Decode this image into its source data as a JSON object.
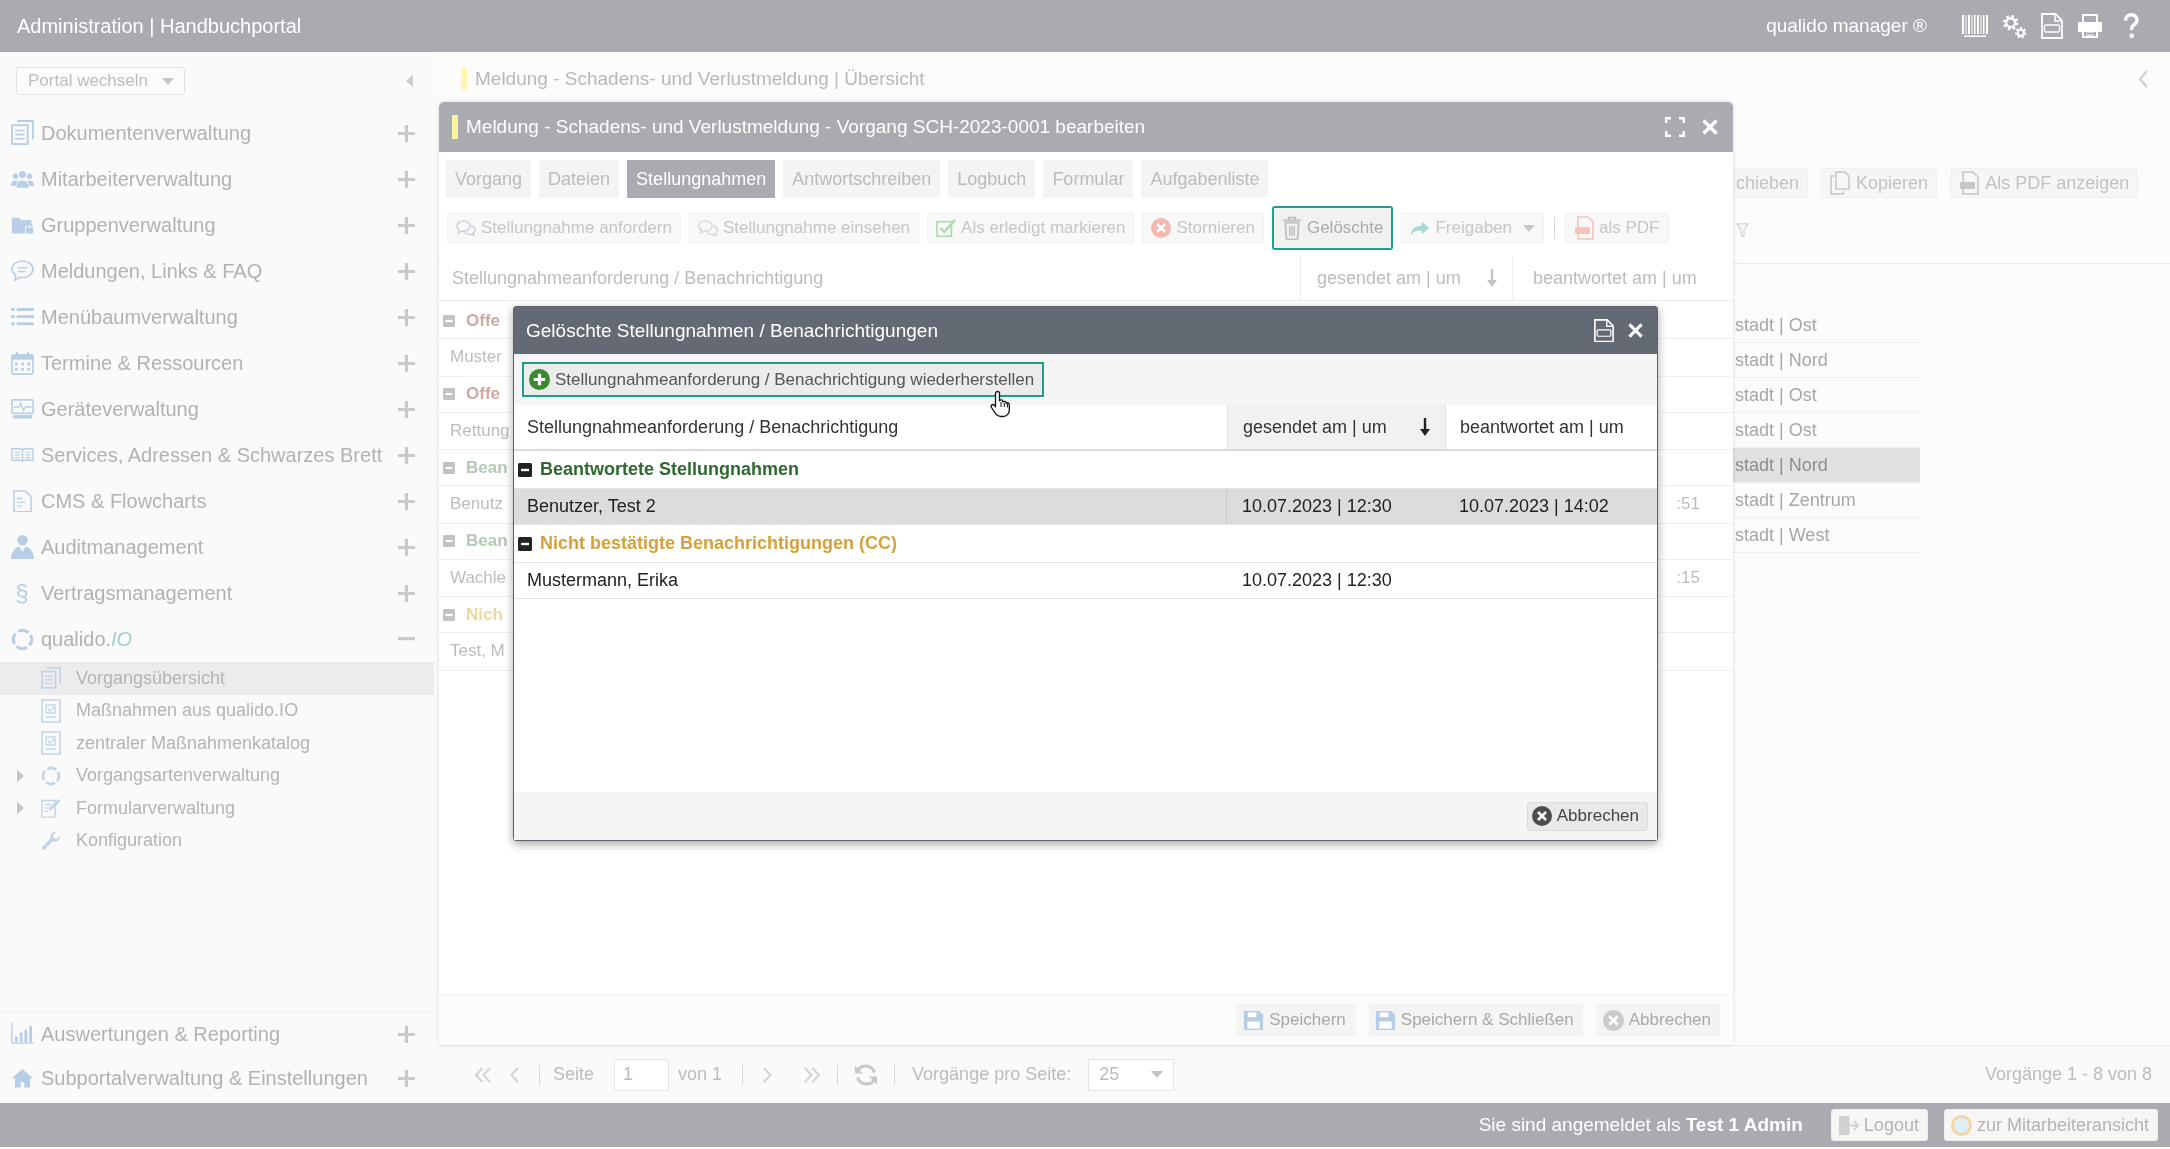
{
  "top_bar": {
    "title": "Administration | Handbuchportal",
    "product": "qualido manager ®"
  },
  "sidebar": {
    "portal_switch": "Portal wechseln",
    "items": [
      {
        "label": "Dokumentenverwaltung",
        "expanded": false
      },
      {
        "label": "Mitarbeiterverwaltung",
        "expanded": false
      },
      {
        "label": "Gruppenverwaltung",
        "expanded": false
      },
      {
        "label": "Meldungen, Links & FAQ",
        "expanded": false
      },
      {
        "label": "Menübaumverwaltung",
        "expanded": false
      },
      {
        "label": "Termine & Ressourcen",
        "expanded": false
      },
      {
        "label": "Geräteverwaltung",
        "expanded": false
      },
      {
        "label": "Services, Adressen & Schwarzes Brett",
        "expanded": false
      },
      {
        "label": "CMS & Flowcharts",
        "expanded": false
      },
      {
        "label": "Auditmanagement",
        "expanded": false
      },
      {
        "label": "Vertragsmanagement",
        "symbol": "§",
        "expanded": false
      },
      {
        "label": "qualido.*IO*",
        "expanded": true,
        "children": [
          {
            "label": "Vorgangsübersicht",
            "kind": "leaf",
            "selected": true
          },
          {
            "label": "Maßnahmen aus qualido.IO",
            "kind": "leaf",
            "selected": false
          },
          {
            "label": "zentraler Maßnahmenkatalog",
            "kind": "leaf",
            "selected": false
          },
          {
            "label": "Vorgangsartenverwaltung",
            "kind": "branch",
            "selected": false
          },
          {
            "label": "Formularverwaltung",
            "kind": "branch",
            "selected": false
          },
          {
            "label": "Konfiguration",
            "kind": "leaf",
            "selected": false
          }
        ]
      }
    ],
    "bottom_items": [
      {
        "label": "Auswertungen & Reporting",
        "expanded": false
      },
      {
        "label": "Subportalverwaltung & Einstellungen",
        "expanded": false
      }
    ]
  },
  "page": {
    "title": "Meldung - Schadens- und Verlustmeldung | Übersicht",
    "toolbar": [
      {
        "kind": "move",
        "label": "chieben"
      },
      {
        "kind": "copy",
        "label": "Kopieren"
      },
      {
        "kind": "pdf",
        "label": "Als PDF anzeigen"
      }
    ],
    "rows": [
      {
        "text": "stadt | Ost",
        "selected": false
      },
      {
        "text": "stadt | Nord",
        "selected": false
      },
      {
        "text": "stadt | Ost",
        "selected": false
      },
      {
        "text": "stadt | Ost",
        "selected": false
      },
      {
        "text": "stadt | Nord",
        "selected": true
      },
      {
        "text": "stadt | Zentrum",
        "selected": false
      },
      {
        "text": "stadt | West",
        "selected": false
      }
    ],
    "pagination": {
      "page_label": "Seite",
      "page": "1",
      "page_total": "von 1",
      "per_page_label": "Vorgänge pro Seite:",
      "per_page": "25",
      "summary": "Vorgänge 1 - 8 von 8"
    }
  },
  "dialog": {
    "title": "Meldung - Schadens- und Verlustmeldung - Vorgang SCH-2023-0001 bearbeiten",
    "tabs": [
      {
        "label": "Vorgang",
        "selected": false
      },
      {
        "label": "Dateien",
        "selected": false
      },
      {
        "label": "Stellungnahmen",
        "selected": true
      },
      {
        "label": "Antwortschreiben",
        "selected": false
      },
      {
        "label": "Logbuch",
        "selected": false
      },
      {
        "label": "Formular",
        "selected": false
      },
      {
        "label": "Aufgabenliste",
        "selected": false
      }
    ],
    "toolbar": [
      {
        "kind": "request",
        "label": "Stellungnahme anfordern",
        "focused": false,
        "dropdown": false
      },
      {
        "kind": "view",
        "label": "Stellungnahme einsehen",
        "focused": false,
        "dropdown": false
      },
      {
        "kind": "complete",
        "label": "Als erledigt markieren",
        "focused": false,
        "dropdown": false
      },
      {
        "kind": "cancel",
        "label": "Stornieren",
        "focused": false,
        "dropdown": false
      },
      {
        "kind": "trash",
        "label": "Gelöschte",
        "focused": true,
        "dropdown": false
      },
      {
        "kind": "share",
        "label": "Freigaben",
        "focused": false,
        "dropdown": true
      },
      {
        "kind": "separator"
      },
      {
        "kind": "pdf",
        "label": "als PDF",
        "focused": false,
        "dropdown": false
      }
    ],
    "columns": [
      {
        "label": "Stellungnahmeanforderung / Benachrichtigung",
        "sorted": false
      },
      {
        "label": "gesendet am | um",
        "sorted": true
      },
      {
        "label": "beantwortet am | um",
        "sorted": false
      }
    ],
    "rows": [
      {
        "kind": "group",
        "text": "Offe",
        "color": "#cfa9a3",
        "expanded": true
      },
      {
        "kind": "item",
        "text": "Muster"
      },
      {
        "kind": "group",
        "text": "Offe",
        "color": "#cfa9a3",
        "expanded": true
      },
      {
        "kind": "item",
        "text": "Rettung"
      },
      {
        "kind": "group",
        "text": "Bean",
        "color": "#b4cab4",
        "expanded": true
      },
      {
        "kind": "item",
        "text": "Benutz",
        "answered": ":51"
      },
      {
        "kind": "group",
        "text": "Bean",
        "color": "#b4cab4",
        "expanded": true
      },
      {
        "kind": "item",
        "text": "Wachle",
        "answered": ":15"
      },
      {
        "kind": "group",
        "text": "Nich",
        "color": "#efd7a0",
        "expanded": true
      },
      {
        "kind": "item",
        "text": "Test, M"
      }
    ],
    "footer_buttons": [
      {
        "kind": "save",
        "label": "Speichern"
      },
      {
        "kind": "save",
        "label": "Speichern & Schließen"
      },
      {
        "kind": "cancel",
        "label": "Abbrechen"
      }
    ]
  },
  "modal": {
    "title": "Gelöschte Stellungnahmen / Benachrichtigungen",
    "restore_button": {
      "label": "Stellungnahmeanforderung / Benachrichtigung wiederherstellen",
      "focused": true
    },
    "columns": [
      {
        "label": "Stellungnahmeanforderung / Benachrichtigung",
        "sorted": false
      },
      {
        "label": "gesendet am | um",
        "sorted": true
      },
      {
        "label": "beantwortet am | um",
        "sorted": false
      }
    ],
    "rows": [
      {
        "kind": "group",
        "text": "Beantwortete Stellungnahmen",
        "color": "#2e6a30",
        "expanded": true
      },
      {
        "kind": "item",
        "text": "Benutzer, Test 2",
        "sent": "10.07.2023 | 12:30",
        "answered": "10.07.2023 | 14:02",
        "selected": true
      },
      {
        "kind": "group",
        "text": "Nicht bestätigte Benachrichtigungen (CC)",
        "color": "#d4a13a",
        "expanded": true
      },
      {
        "kind": "item",
        "text": "Mustermann, Erika",
        "sent": "10.07.2023 | 12:30",
        "selected": false
      }
    ],
    "cancel_button": "Abbrechen"
  },
  "status_bar": {
    "greeting": "Sie sind angemeldet als **Test 1 Admin**",
    "buttons": [
      {
        "kind": "logout",
        "label": "Logout"
      },
      {
        "kind": "switch",
        "label": "zur Mitarbeiteransicht"
      }
    ]
  }
}
